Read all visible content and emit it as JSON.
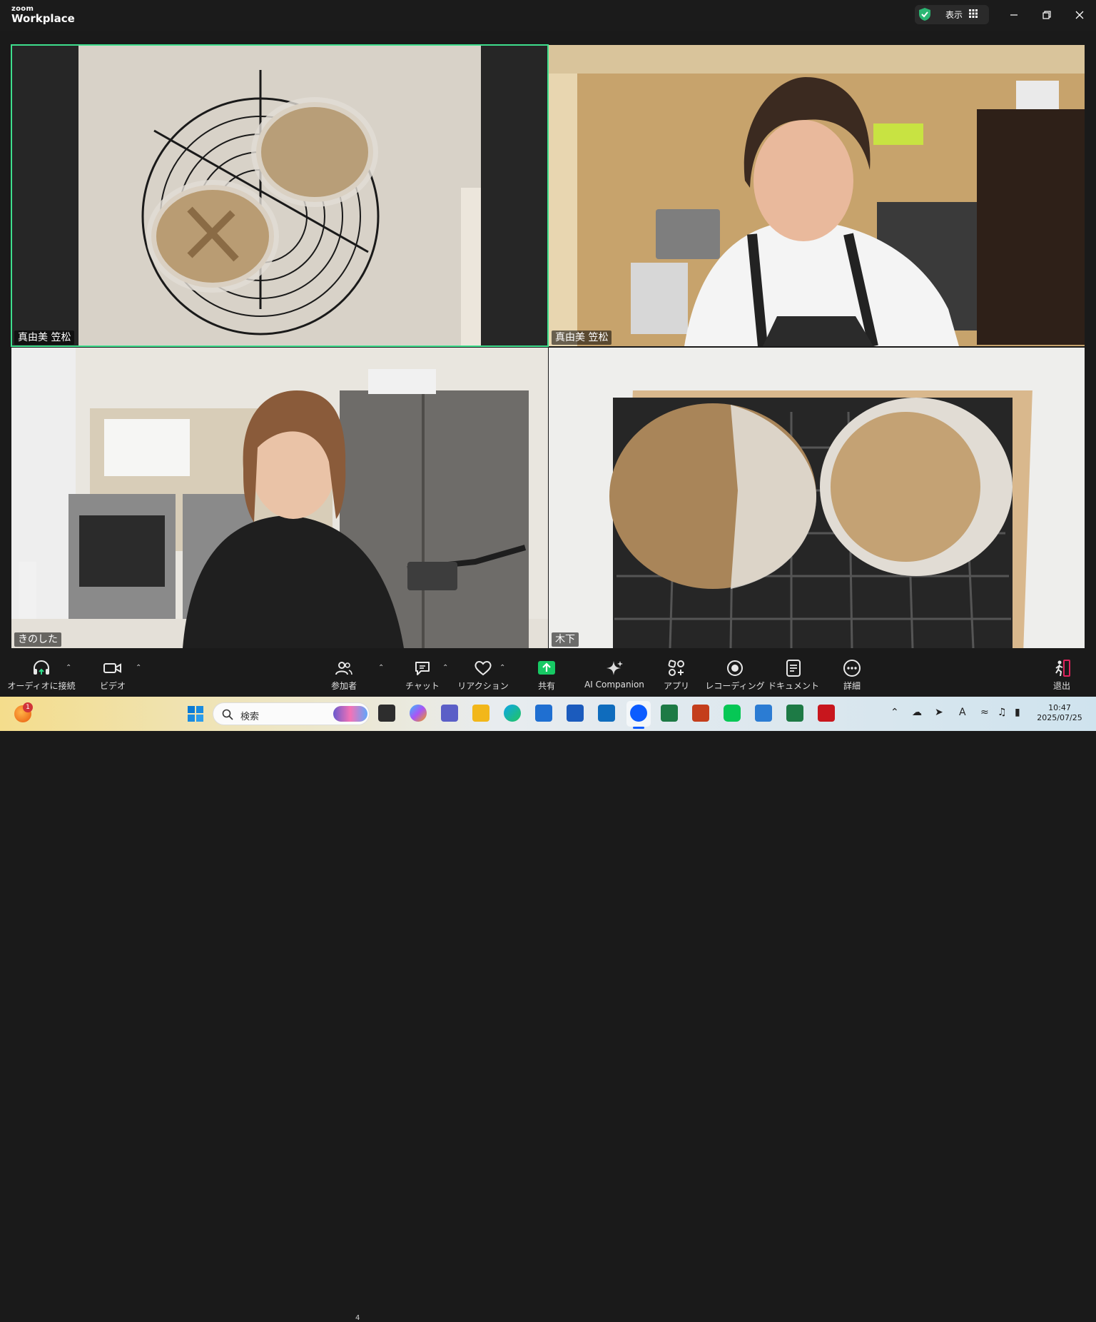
{
  "titlebar": {
    "brand_small": "zoom",
    "brand_large": "Workplace",
    "view_label": "表示"
  },
  "tiles": [
    {
      "name": "真由美 笠松",
      "content": "bread-on-cooling-rack"
    },
    {
      "name": "真由美 笠松",
      "content": "participant-camera"
    },
    {
      "name": "きのした",
      "content": "participant-camera"
    },
    {
      "name": "木下",
      "content": "bread-on-grid"
    }
  ],
  "toolbar": {
    "audio_label": "オーディオに接続",
    "video_label": "ビデオ",
    "participants_label": "参加者",
    "participants_count": "4",
    "chat_label": "チャット",
    "reactions_label": "リアクション",
    "share_label": "共有",
    "ai_label": "AI Companion",
    "apps_label": "アプリ",
    "record_label": "レコーディング",
    "docs_label": "ドキュメント",
    "more_label": "詳細",
    "leave_label": "退出"
  },
  "taskbar": {
    "search_placeholder": "検索",
    "notification_count": "1",
    "time": "10:47",
    "date": "2025/07/25"
  },
  "colors": {
    "active_speaker": "#3ede8d",
    "share_green": "#17c964",
    "leave_red": "#e0245e"
  }
}
